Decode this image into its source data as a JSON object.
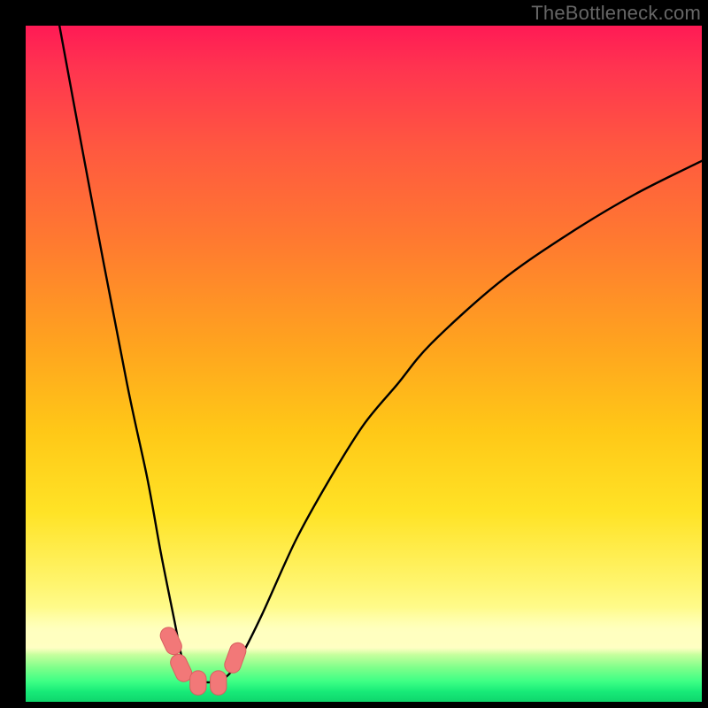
{
  "watermark": "TheBottleneck.com",
  "colors": {
    "frame": "#000000",
    "gradient_top": "#ff1a55",
    "gradient_mid": "#ffc817",
    "gradient_bottom_yellow": "#ffffc0",
    "gradient_green": "#17ea78",
    "curve": "#000000",
    "marker": "#f27878"
  },
  "chart_data": {
    "type": "line",
    "title": "",
    "xlabel": "",
    "ylabel": "",
    "xlim": [
      0,
      100
    ],
    "ylim": [
      0,
      100
    ],
    "grid": false,
    "legend": false,
    "notes": "V-shaped bottleneck curve on a heat-gradient background. Axes are unlabeled; values are read as percent of plot width/height (0 = left/bottom, 100 = right/top). Left branch is steep, right branch is gentler and asymptotic around y≈80 at x=100. Trough sits near x≈23–30, y≈3.",
    "series": [
      {
        "name": "curve",
        "x": [
          5,
          10,
          15,
          18,
          20,
          22,
          23,
          24,
          26,
          28,
          30,
          32,
          35,
          40,
          45,
          50,
          55,
          60,
          70,
          80,
          90,
          100
        ],
        "y": [
          100,
          73,
          47,
          33,
          22,
          12,
          7,
          4,
          3,
          3,
          4,
          7,
          13,
          24,
          33,
          41,
          47,
          53,
          62,
          69,
          75,
          80
        ]
      }
    ],
    "markers": {
      "name": "trough-markers",
      "shape": "rounded-rect",
      "color": "#f27878",
      "points": [
        {
          "x": 21.5,
          "y": 9,
          "w": 2.4,
          "h": 4.2,
          "angle": -25
        },
        {
          "x": 23.0,
          "y": 5,
          "w": 2.4,
          "h": 4.2,
          "angle": -25
        },
        {
          "x": 25.5,
          "y": 2.8,
          "w": 2.4,
          "h": 3.6,
          "angle": 0
        },
        {
          "x": 28.5,
          "y": 2.8,
          "w": 2.4,
          "h": 3.6,
          "angle": 0
        },
        {
          "x": 31.0,
          "y": 6.5,
          "w": 2.4,
          "h": 4.6,
          "angle": 20
        }
      ]
    }
  }
}
